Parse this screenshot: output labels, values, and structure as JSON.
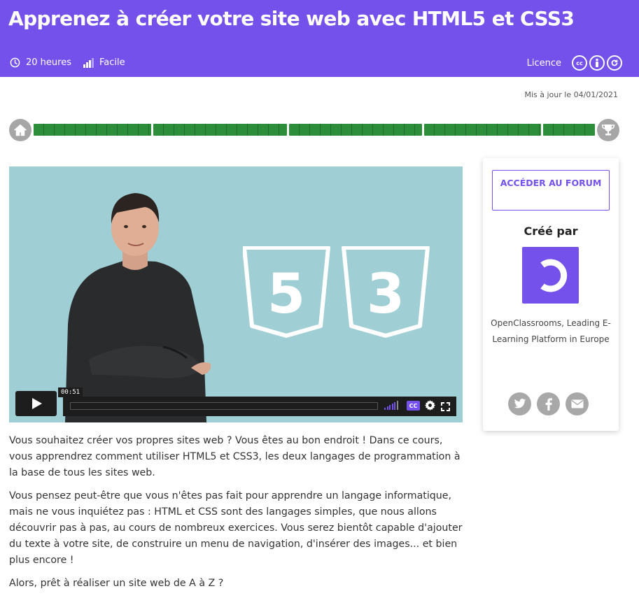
{
  "header": {
    "title": "Apprenez à créer votre site web avec HTML5 et CSS3",
    "duration": "20 heures",
    "level": "Facile",
    "licence_label": "Licence",
    "licence_badges": [
      "cc",
      "by",
      "sa"
    ]
  },
  "updated": "Mis à jour le 04/01/2021",
  "progress": {
    "segments": 5
  },
  "video": {
    "time": "00:51",
    "badge_numbers": [
      "5",
      "3"
    ],
    "cc_label": "CC",
    "background_color": "#9fcfd4"
  },
  "description": [
    "Vous souhaitez créer vos propres sites web ? Vous êtes au bon endroit ! Dans ce cours, vous apprendrez comment utiliser HTML5 et CSS3, les deux langages de programmation à la base de tous les sites web.",
    "Vous pensez peut-être que vous n'êtes pas fait pour apprendre un langage informatique, mais ne vous inquiétez pas : HTML et CSS sont des langages simples, que nous allons découvrir pas à pas, au cours de nombreux exercices. Vous serez bientôt capable d'ajouter du texte à votre site, de construire un menu de navigation, d'insérer des images... et bien plus encore !",
    "Alors, prêt à réaliser un site web de A à Z ?"
  ],
  "sidebar": {
    "forum_button": "ACCÉDER AU FORUM",
    "created_by": "Créé par",
    "author": "OpenClassrooms, Leading E-Learning Platform in Europe",
    "share_icons": [
      "twitter-icon",
      "facebook-icon",
      "email-icon"
    ]
  },
  "colors": {
    "brand": "#7451eb",
    "progress": "#2c8d3a",
    "icon_gray": "#a8a8a8"
  }
}
